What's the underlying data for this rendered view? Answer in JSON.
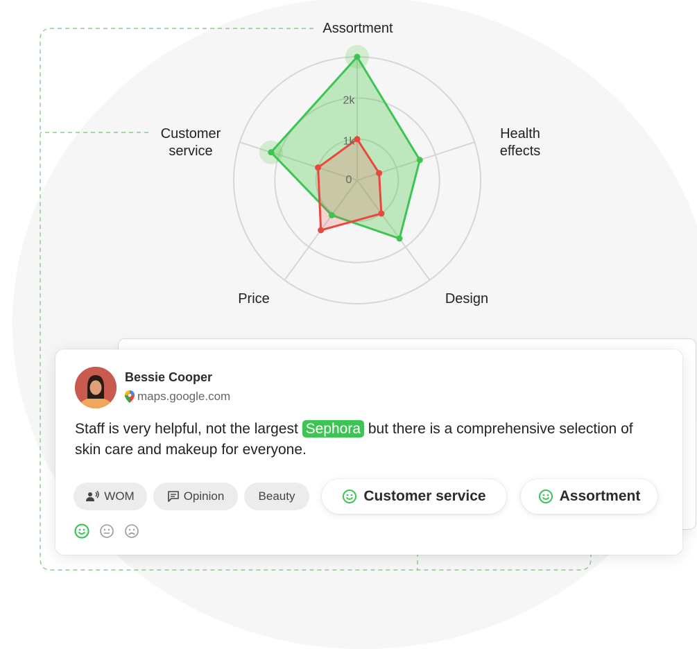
{
  "colors": {
    "green": "#3dc553",
    "green_fill": "rgba(76,200,70,0.32)",
    "red": "#e8483d",
    "red_fill": "rgba(232,90,80,0.22)",
    "grid": "#d6d6d6",
    "connector": "#8cc98c"
  },
  "radar": {
    "axes": [
      "Assortment",
      "Health\neffects",
      "Design",
      "Price",
      "Customer\nservice"
    ],
    "tick_labels": [
      "0",
      "1k",
      "2k"
    ],
    "max": 3000,
    "series": [
      {
        "values": [
          3000,
          1600,
          1750,
          1050,
          2200
        ],
        "color": "#3dc553"
      },
      {
        "values": [
          1000,
          560,
          1000,
          1500,
          1000
        ],
        "color": "#e8483d"
      }
    ],
    "highlighted_axes": [
      0,
      4
    ]
  },
  "review": {
    "author": "Bessie Cooper",
    "source": "maps.google.com",
    "text_before": "Staff is very helpful, not the largest ",
    "brand": "Sephora",
    "text_after": " but there is a comprehensive selection of skin care and makeup for everyone.",
    "chips": [
      {
        "label": "WOM",
        "icon": "speaker-icon"
      },
      {
        "label": "Opinion",
        "icon": "comment-icon"
      },
      {
        "label": "Beauty",
        "icon": ""
      }
    ],
    "topics": [
      {
        "label": "Customer service",
        "icon": "smile-icon"
      },
      {
        "label": "Assortment",
        "icon": "smile-icon"
      }
    ],
    "sentiments": [
      "positive",
      "neutral",
      "negative"
    ],
    "selected_sentiment": "positive"
  }
}
